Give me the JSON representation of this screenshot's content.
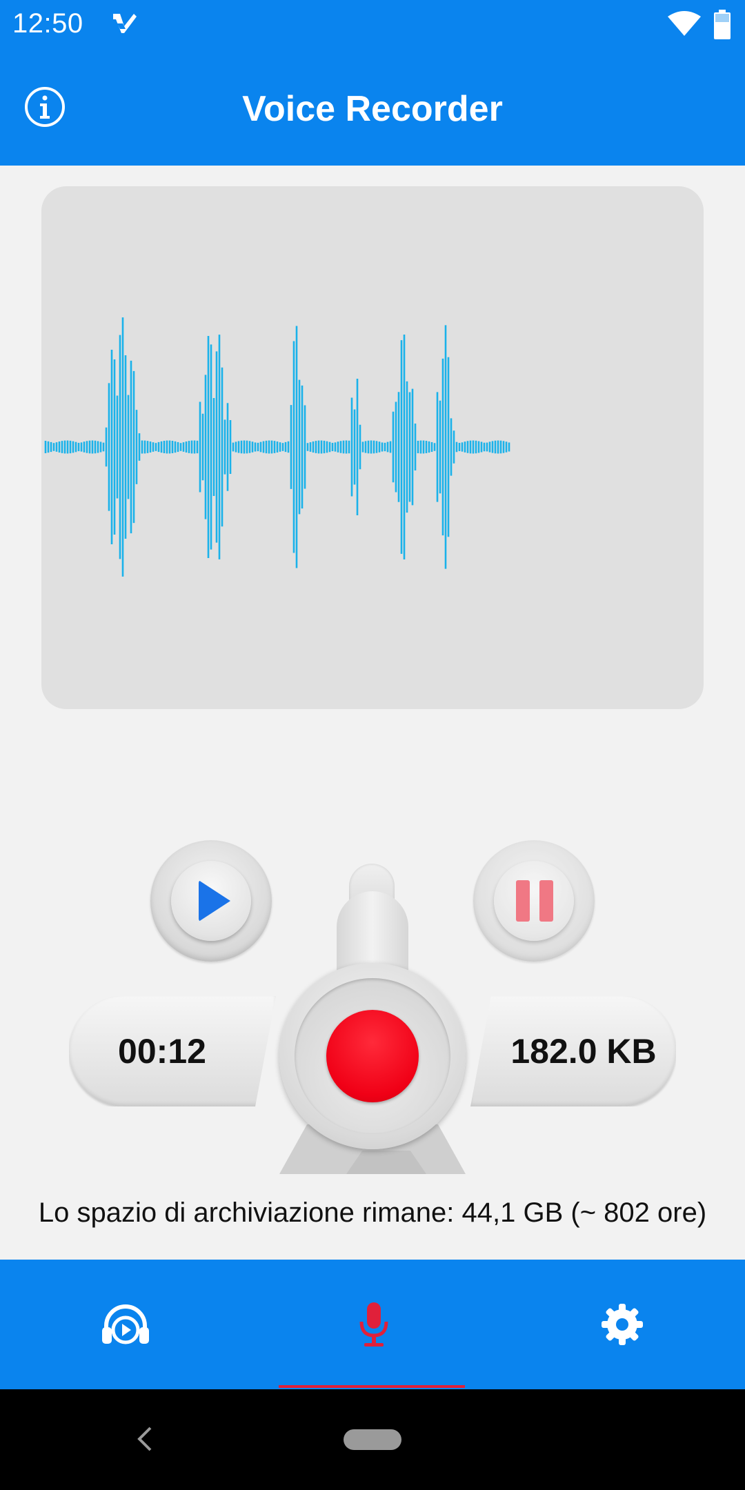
{
  "status_bar": {
    "time": "12:50",
    "icons": [
      "app-notification-icon",
      "wifi-icon",
      "battery-icon"
    ]
  },
  "app_bar": {
    "title": "Voice Recorder",
    "info_icon": "info-icon",
    "background_color": "#0a84ee"
  },
  "waveform": {
    "color": "#1ab2ea",
    "panel_color": "#e0e0e0"
  },
  "controls": {
    "play_icon": "play-icon",
    "pause_icon": "pause-icon",
    "record_icon": "record-icon",
    "elapsed_time": "00:12",
    "file_size": "182.0 KB",
    "record_color": "#f00016",
    "play_color": "#1a73e8",
    "pause_color": "#f05060"
  },
  "storage": {
    "text": "Lo spazio di archiviazione rimane: 44,1 GB (~ 802 ore)"
  },
  "bottom_nav": {
    "items": [
      {
        "icon": "playback-headphones-icon",
        "active": false
      },
      {
        "icon": "microphone-icon",
        "active": true
      },
      {
        "icon": "settings-gear-icon",
        "active": false
      }
    ],
    "active_color": "#e0203a"
  },
  "system_nav": {
    "icons": [
      "back-icon",
      "home-icon"
    ]
  }
}
